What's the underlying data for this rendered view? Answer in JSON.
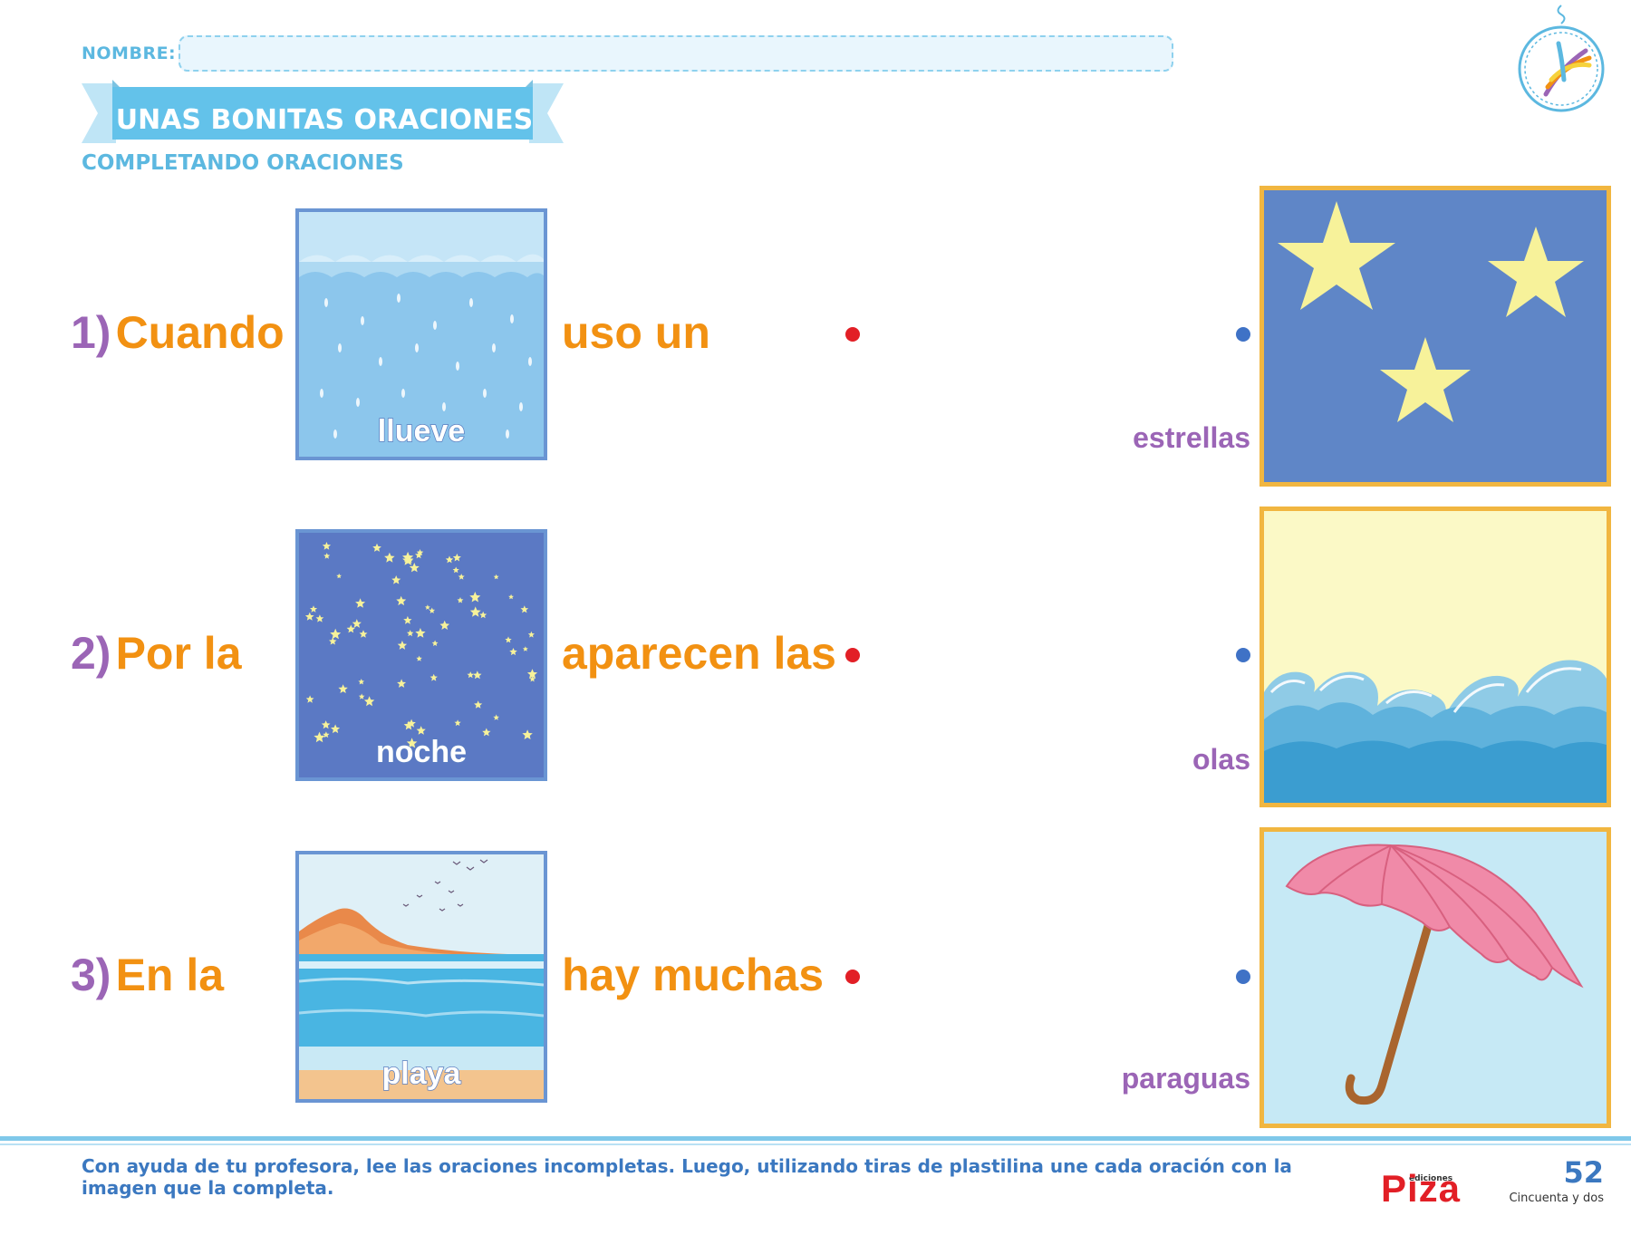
{
  "header": {
    "name_label": "NOMBRE:",
    "title": "UNAS BONITAS ORACIONES",
    "subtitle": "COMPLETANDO ORACIONES"
  },
  "sentences": [
    {
      "number": "1)",
      "before": "Cuando",
      "picture_word": "llueve",
      "after": "uso un"
    },
    {
      "number": "2)",
      "before": "Por la",
      "picture_word": "noche",
      "after": "aparecen las"
    },
    {
      "number": "3)",
      "before": "En la",
      "picture_word": "playa",
      "after": "hay muchas"
    }
  ],
  "answers": [
    {
      "label": "estrellas",
      "image": "stars-picture"
    },
    {
      "label": "olas",
      "image": "waves-picture"
    },
    {
      "label": "paraguas",
      "image": "umbrella-picture"
    }
  ],
  "footer": {
    "instruction": "Con ayuda de tu profesora, lee las oraciones incompletas. Luego, utilizando tiras de plastilina une cada oración con la imagen que la completa.",
    "brand_small": "ediciones",
    "brand": "Piza",
    "page_number": "52",
    "page_words": "Cincuenta y dos"
  },
  "colors": {
    "title_blue": "#5cb8e0",
    "number_purple": "#9b65b6",
    "word_orange": "#f29112",
    "left_dot_red": "#e21f26",
    "right_dot_blue": "#3f72c6",
    "frame_gold": "#f1b640"
  }
}
